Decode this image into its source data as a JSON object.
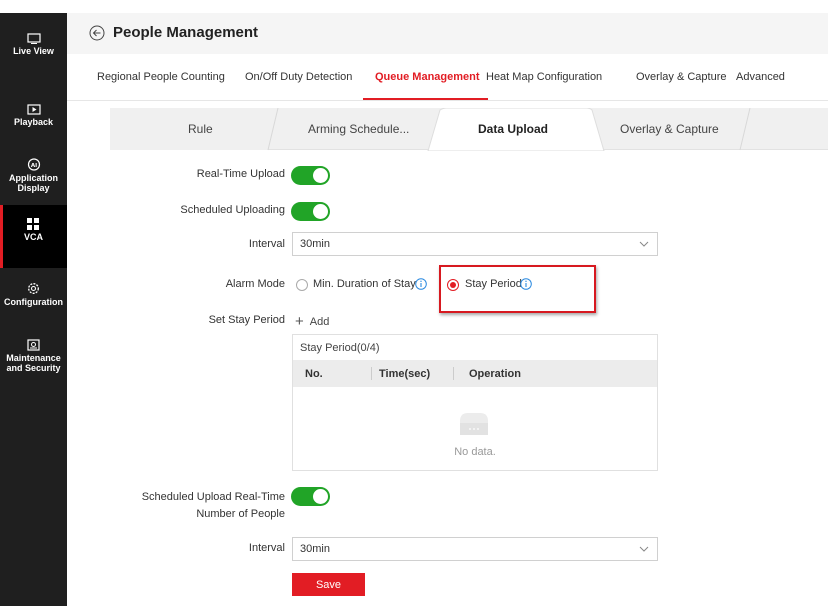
{
  "sidebar": {
    "items": [
      {
        "label": "Live View",
        "icon": "monitor-icon"
      },
      {
        "label": "Playback",
        "icon": "play-icon"
      },
      {
        "label": "Application Display",
        "icon": "ai-icon"
      },
      {
        "label": "VCA",
        "icon": "grid-icon",
        "active": true
      },
      {
        "label": "Configuration",
        "icon": "gear-icon"
      },
      {
        "label": "Maintenance and Security",
        "icon": "shield-icon"
      }
    ]
  },
  "header": {
    "title": "People Management"
  },
  "tabs": [
    {
      "label": "Regional People Counting"
    },
    {
      "label": "On/Off Duty Detection"
    },
    {
      "label": "Queue Management",
      "active": true
    },
    {
      "label": "Heat Map Configuration"
    },
    {
      "label": "Overlay & Capture"
    },
    {
      "label": "Advanced"
    }
  ],
  "subtabs": [
    {
      "label": "Rule"
    },
    {
      "label": "Arming Schedule..."
    },
    {
      "label": "Data Upload",
      "active": true
    },
    {
      "label": "Overlay & Capture"
    }
  ],
  "form": {
    "realtime_upload_label": "Real-Time Upload",
    "realtime_upload_on": true,
    "scheduled_uploading_label": "Scheduled Uploading",
    "scheduled_uploading_on": true,
    "interval_label": "Interval",
    "interval_value": "30min",
    "alarm_mode_label": "Alarm Mode",
    "alarm_mode_options": [
      "Min. Duration of Stay",
      "Stay Period"
    ],
    "alarm_mode_selected": "Stay Period",
    "set_stay_period_label": "Set Stay Period",
    "add_label": "Add",
    "table": {
      "caption": "Stay Period(0/4)",
      "columns": [
        "No.",
        "Time(sec)",
        "Operation"
      ],
      "empty_text": "No data."
    },
    "scheduled_realtime_label_line1": "Scheduled Upload Real-Time",
    "scheduled_realtime_label_line2": "Number of People",
    "scheduled_realtime_on": true,
    "interval2_label": "Interval",
    "interval2_value": "30min",
    "save_label": "Save"
  },
  "colors": {
    "accent": "#e21d24",
    "toggle_on": "#21a427",
    "sidebar_bg": "#1f1f1f"
  }
}
